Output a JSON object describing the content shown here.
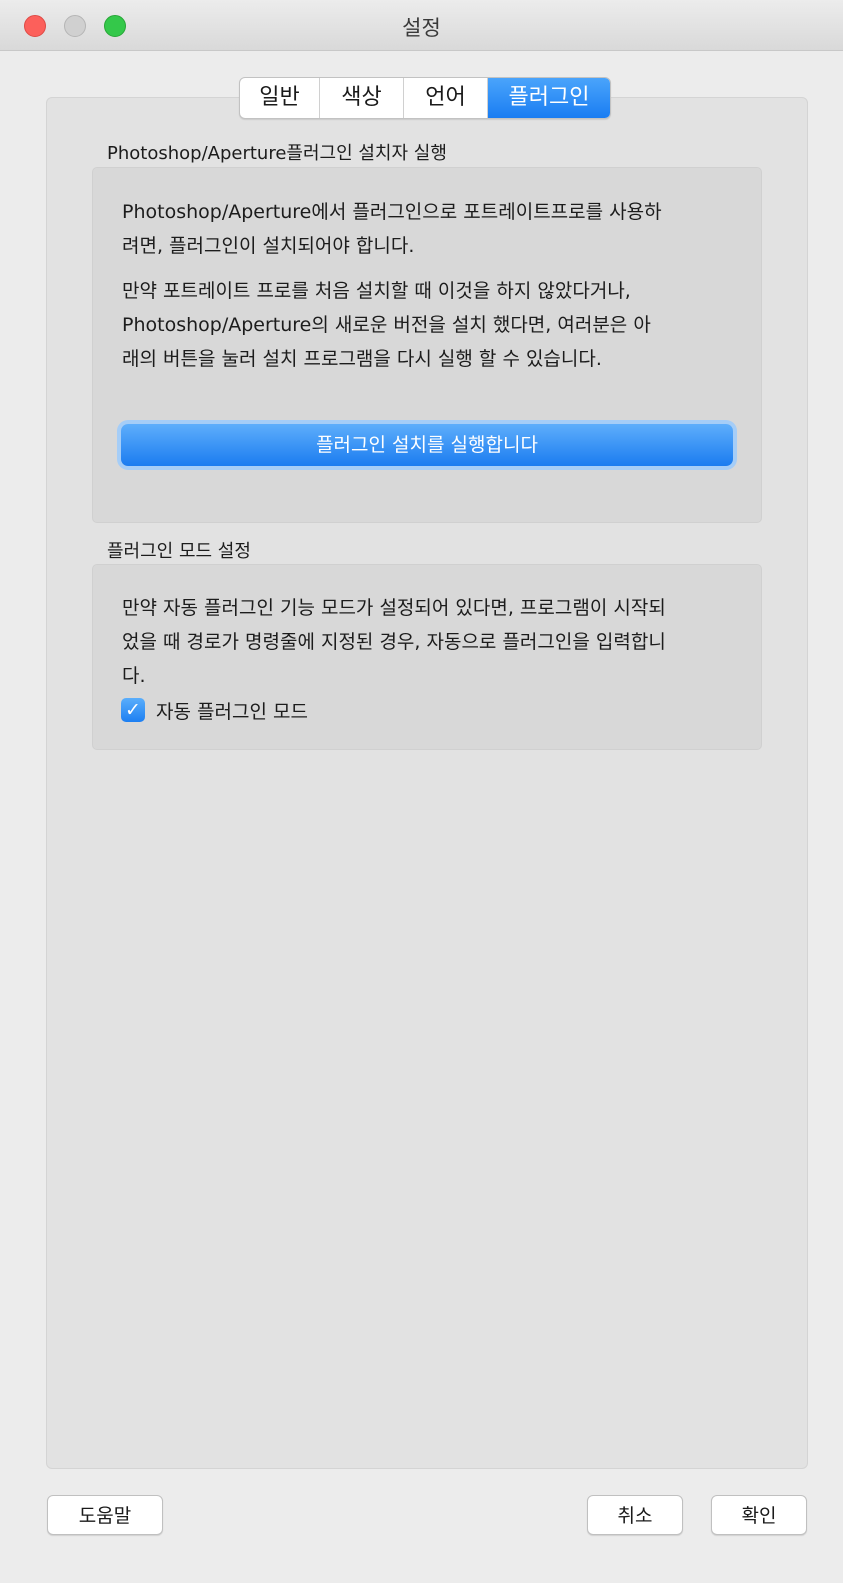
{
  "window": {
    "title": "설정"
  },
  "tabs": [
    {
      "label": "일반",
      "active": false
    },
    {
      "label": "색상",
      "active": false
    },
    {
      "label": "언어",
      "active": false
    },
    {
      "label": "플러그인",
      "active": true
    }
  ],
  "installer_section": {
    "heading": "Photoshop/Aperture플러그인 설치자 실행",
    "line1": "Photoshop/Aperture에서 플러그인으로 포트레이트프로를 사용하",
    "line2": "려면, 플러그인이 설치되어야 합니다.",
    "line3": "만약 포트레이트 프로를 처음 설치할 때 이것을 하지 않았다거나,",
    "line4": "Photoshop/Aperture의 새로운 버전을 설치 했다면, 여러분은 아",
    "line5": "래의 버튼을 눌러 설치 프로그램을 다시 실행 할 수 있습니다.",
    "button_label": "플러그인 설치를 실행합니다"
  },
  "mode_section": {
    "heading": "플러그인 모드 설정",
    "line1": "만약 자동 플러그인 기능 모드가 설정되어 있다면, 프로그램이 시작되",
    "line2": "었을 때 경로가 명령줄에 지정된 경우, 자동으로 플러그인을 입력합니",
    "line3": "다.",
    "checkbox_label": "자동 플러그인 모드",
    "checkbox_checked": true,
    "checkbox_mark": "✓"
  },
  "footer": {
    "help_label": "도움말",
    "cancel_label": "취소",
    "ok_label": "확인"
  }
}
